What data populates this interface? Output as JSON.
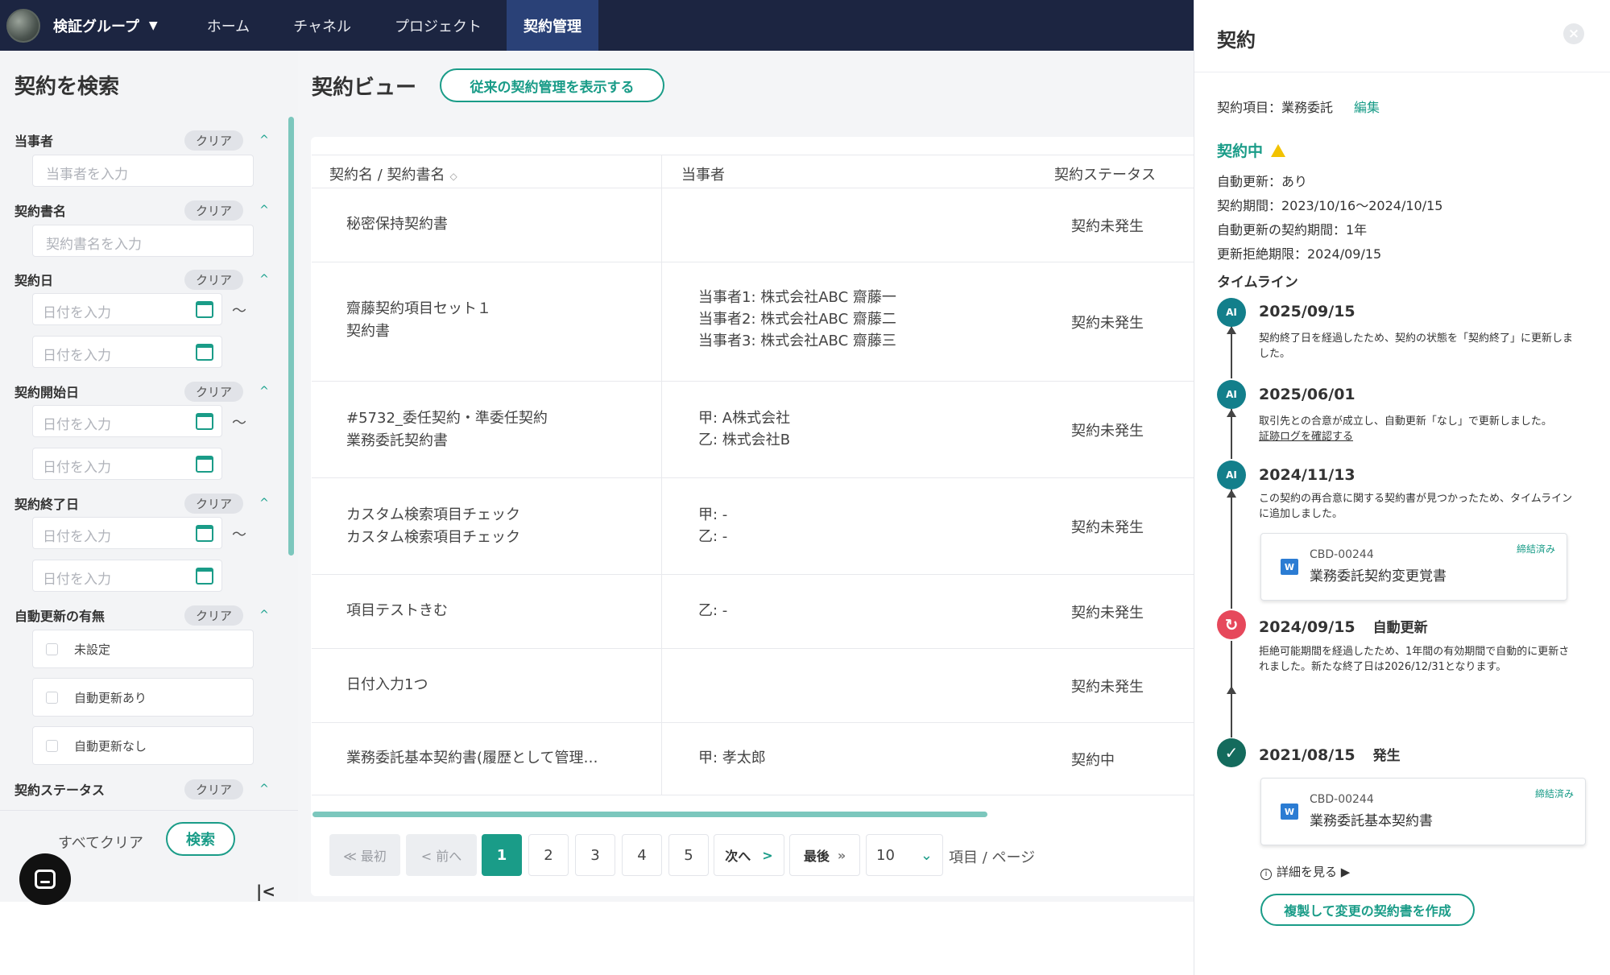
{
  "nav": {
    "org_name": "検証グループ",
    "org_caret": "▼",
    "items": [
      "ホーム",
      "チャネル",
      "プロジェクト",
      "契約管理"
    ],
    "active": "契約管理"
  },
  "search": {
    "title": "契約を検索",
    "clear_label": "クリア",
    "caret": "^",
    "fields": {
      "party": {
        "label": "当事者",
        "placeholder": "当事者を入力"
      },
      "doc_name": {
        "label": "契約書名",
        "placeholder": "契約書名を入力"
      },
      "contract_date": {
        "label": "契約日"
      },
      "start_date": {
        "label": "契約開始日"
      },
      "end_date": {
        "label": "契約終了日"
      },
      "auto_renew": {
        "label": "自動更新の有無",
        "options": [
          "未設定",
          "自動更新あり",
          "自動更新なし"
        ]
      },
      "status": {
        "label": "契約ステータス"
      }
    },
    "date_placeholder": "日付を入力",
    "tilde": "〜",
    "clear_all": "すべてクリア",
    "search_button": "検索",
    "collapse": "|<"
  },
  "main": {
    "title": "契約ビュー",
    "legacy_button": "従来の契約管理を表示する",
    "columns": [
      "契約名 / 契約書名",
      "当事者",
      "契約ステータス"
    ],
    "sort_icon": "◇",
    "rows": [
      {
        "name": "秘密保持契約書",
        "party": "",
        "status": "契約未発生"
      },
      {
        "name": "齋藤契約項目セット１\n契約書",
        "party": "当事者1: 株式会社ABC 齋藤一\n当事者2: 株式会社ABC 齋藤二\n当事者3: 株式会社ABC 齋藤三",
        "status": "契約未発生"
      },
      {
        "name": "#5732_委任契約・準委任契約\n業務委託契約書",
        "party": "甲: A株式会社\n乙: 株式会社B",
        "status": "契約未発生"
      },
      {
        "name": "カスタム検索項目チェック\nカスタム検索項目チェック",
        "party": "甲: -\n乙: -",
        "status": "契約未発生"
      },
      {
        "name": "項目テストきむ",
        "party": "乙: -",
        "status": "契約未発生"
      },
      {
        "name": "日付入力1つ",
        "party": "",
        "status": "契約未発生"
      },
      {
        "name": "業務委託基本契約書(履歴として管理…",
        "party": "甲: 孝太郎",
        "status": "契約中"
      }
    ],
    "pagination": {
      "first": "≪ 最初",
      "prev": "< 前へ",
      "pages": [
        "1",
        "2",
        "3",
        "4",
        "5"
      ],
      "current": "1",
      "next": "次へ",
      "next_arrow": ">",
      "last": "最後",
      "last_arrow": "»",
      "per_page": "10",
      "per_page_caret": "⌄",
      "per_page_label": "項目 / ページ"
    }
  },
  "detail": {
    "title": "契約",
    "close": "×",
    "item_label": "契約項目：業務委託",
    "edit": "編集",
    "status": "契約中",
    "auto_renew": "自動更新：あり",
    "period": "契約期間：2023/10/16〜2024/10/15",
    "renew_period": "自動更新の契約期間：1年",
    "refusal_deadline": "更新拒絶期限：2024/09/15",
    "timeline_label": "タイムライン",
    "timeline": [
      {
        "icon": "AI",
        "date": "2025/09/15",
        "tag": "",
        "desc": "契約終了日を経過したため、契約の状態を「契約終了」に更新しました。"
      },
      {
        "icon": "AI",
        "date": "2025/06/01",
        "tag": "",
        "desc": "取引先との合意が成立し、自動更新「なし」で更新しました。",
        "link": "証跡ログを確認する"
      },
      {
        "icon": "AI",
        "date": "2024/11/13",
        "tag": "",
        "desc": "この契約の再合意に関する契約書が見つかったため、タイムラインに追加しました。",
        "doc": {
          "code": "CBD-00244",
          "name": "業務委託契約変更覚書",
          "badge": "締結済み"
        }
      },
      {
        "icon": "↻",
        "date": "2024/09/15",
        "tag": "自動更新",
        "desc": "拒絶可能期間を経過したため、1年間の有効期間で自動的に更新されました。新たな終了日は2026/12/31となります。"
      },
      {
        "icon": "✓",
        "date": "2021/08/15",
        "tag": "発生",
        "desc": "",
        "doc": {
          "code": "CBD-00244",
          "name": "業務委託基本契約書",
          "badge": "締結済み"
        }
      }
    ],
    "more": "詳細を見る ▶",
    "info_icon": "i",
    "word_icon": "W",
    "duplicate_button": "複製して変更の契約書を作成"
  }
}
